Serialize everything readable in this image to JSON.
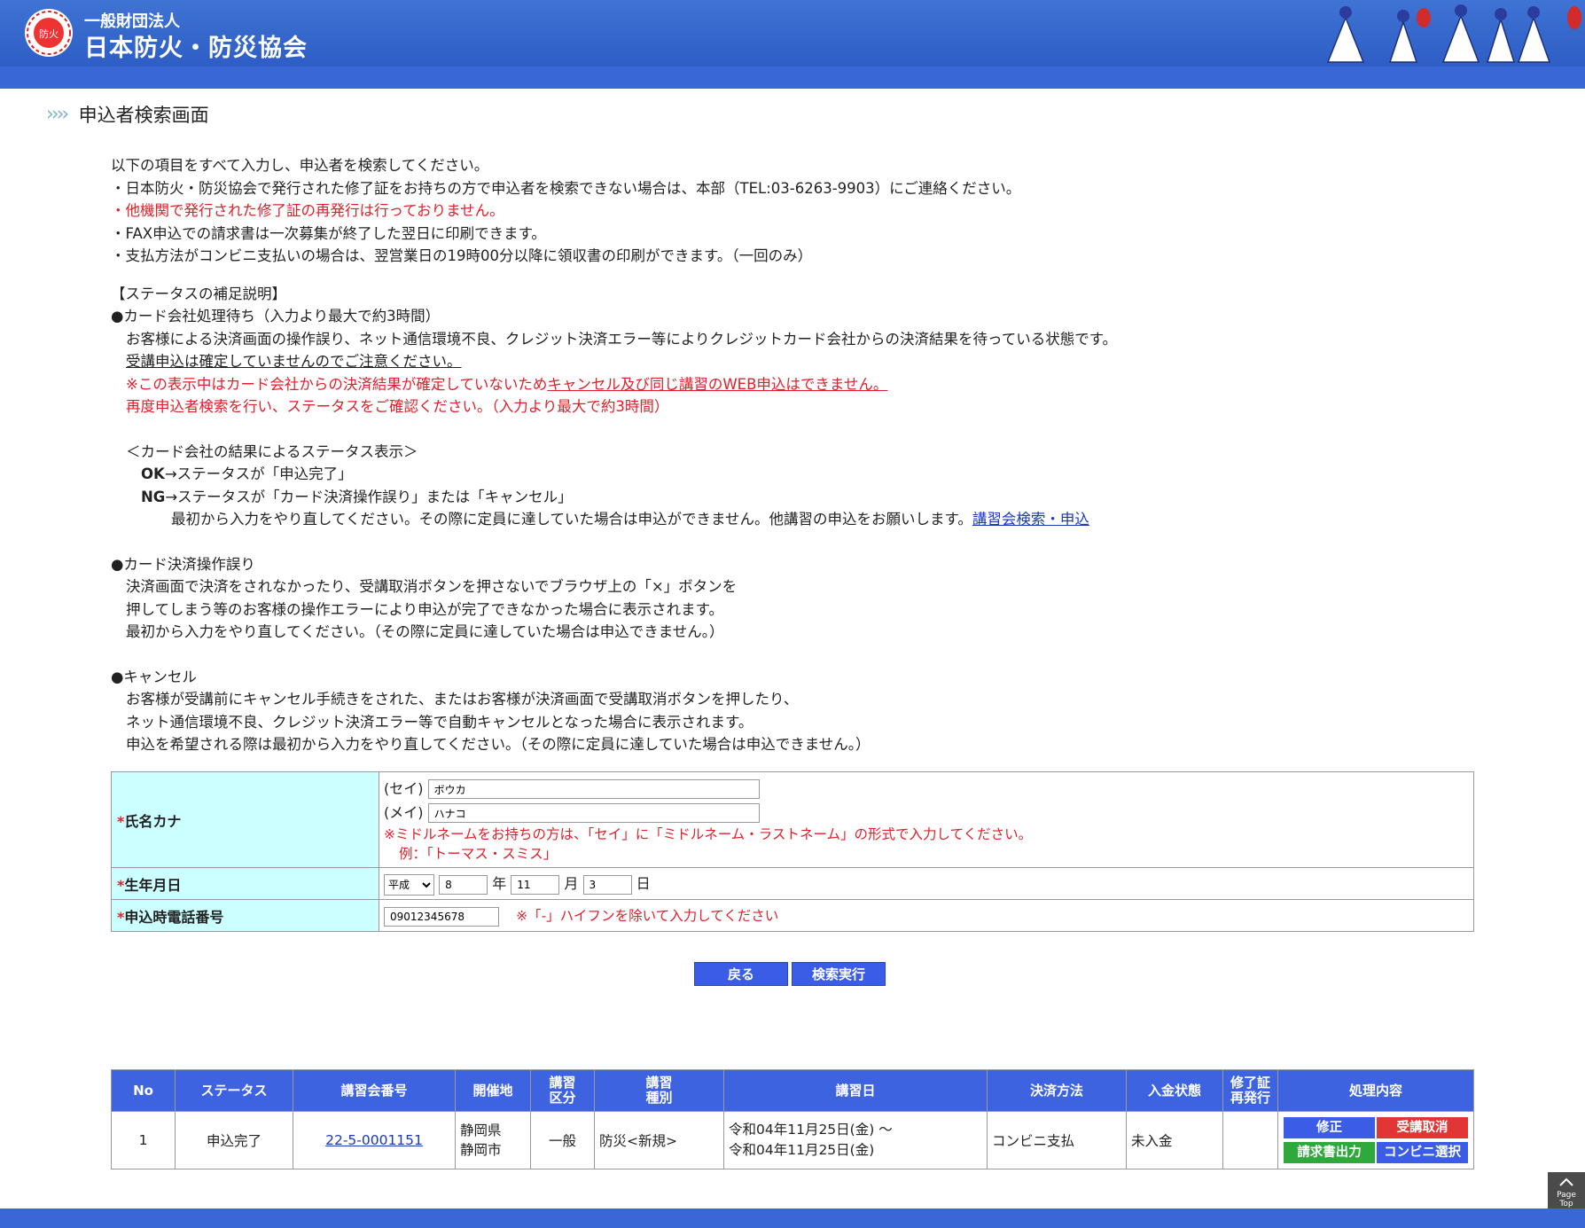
{
  "header": {
    "org_small": "一般財団法人",
    "org_name": "日本防火・防災協会",
    "logo_mark_text": "防火"
  },
  "page_title": "申込者検索画面",
  "intro": {
    "lead": "以下の項目をすべて入力し、申込者を検索してください。",
    "bullet1": "・日本防火・防災協会で発行された修了証をお持ちの方で申込者を検索できない場合は、本部（TEL:03-6263-9903）にご連絡ください。",
    "bullet2": "・他機関で発行された修了証の再発行は行っておりません。",
    "bullet3": "・FAX申込での請求書は一次募集が終了した翌日に印刷できます。",
    "bullet4": "・支払方法がコンビニ支払いの場合は、翌営業日の19時00分以降に領収書の印刷ができます。（一回のみ）"
  },
  "status_help": {
    "heading": "【ステータスの補足説明】",
    "card_wait": {
      "title": "●カード会社処理待ち（入力より最大で約3時間）",
      "line1": "お客様による決済画面の操作誤り、ネット通信環境不良、クレジット決済エラー等によりクレジットカード会社からの決済結果を待っている状態です。",
      "line2": "受講申込は確定していませんのでご注意ください。",
      "line3_a": "※この表示中はカード会社からの決済結果が確定していないため",
      "line3_b": "キャンセル及び同じ講習のWEB申込はできません。",
      "line4": "再度申込者検索を行い、ステータスをご確認ください。（入力より最大で約3時間）",
      "result_heading": "＜カード会社の結果によるステータス表示＞",
      "ok_key": "OK",
      "ok_text": "→ステータスが「申込完了」",
      "ng_key": "NG",
      "ng_text": "→ステータスが「カード決済操作誤り」または「キャンセル」",
      "ng_detail": "最初から入力をやり直してください。その際に定員に達していた場合は申込ができません。他講習の申込をお願いします。",
      "ng_link": "講習会検索・申込"
    },
    "card_error": {
      "title": "●カード決済操作誤り",
      "line1": "決済画面で決済をされなかったり、受講取消ボタンを押さないでブラウザ上の「×」ボタンを",
      "line2": "押してしまう等のお客様の操作エラーにより申込が完了できなかった場合に表示されます。",
      "line3": "最初から入力をやり直してください。（その際に定員に達していた場合は申込できません。）"
    },
    "cancel": {
      "title": "●キャンセル",
      "line1": "お客様が受講前にキャンセル手続きをされた、またはお客様が決済画面で受講取消ボタンを押したり、",
      "line2": "ネット通信環境不良、クレジット決済エラー等で自動キャンセルとなった場合に表示されます。",
      "line3": "申込を希望される際は最初から入力をやり直してください。（その際に定員に達していた場合は申込できません。）"
    }
  },
  "form": {
    "required_mark": "*",
    "name_label": "氏名カナ",
    "sei_label": "(セイ)",
    "sei_value": "ボウカ",
    "mei_label": "(メイ)",
    "mei_value": "ハナコ",
    "name_note1": "※ミドルネームをお持ちの方は、「セイ」に「ミドルネーム・ラストネーム」の形式で入力してください。",
    "name_note2": "例：「トーマス・スミス」",
    "birth_label": "生年月日",
    "era_value": "平成",
    "year_value": "8",
    "year_unit": "年",
    "month_value": "11",
    "month_unit": "月",
    "day_value": "3",
    "day_unit": "日",
    "phone_label": "申込時電話番号",
    "phone_value": "09012345678",
    "phone_note": "※「-」ハイフンを除いて入力してください"
  },
  "buttons": {
    "back": "戻る",
    "search": "検索実行"
  },
  "results": {
    "headers": {
      "no": "No",
      "status": "ステータス",
      "course_no": "講習会番号",
      "venue": "開催地",
      "kubun_1": "講習",
      "kubun_2": "区分",
      "shubetsu_1": "講習",
      "shubetsu_2": "種別",
      "date": "講習日",
      "payment": "決済方法",
      "deposit": "入金状態",
      "cert_1": "修了証",
      "cert_2": "再発行",
      "action": "処理内容"
    },
    "row": {
      "no": "1",
      "status": "申込完了",
      "course_no": "22-5-0001151",
      "venue_1": "静岡県",
      "venue_2": "静岡市",
      "kubun": "一般",
      "shubetsu": "防災<新規>",
      "date_1": "令和04年11月25日(金) ～",
      "date_2": "令和04年11月25日(金)",
      "payment": "コンビニ支払",
      "deposit": "未入金",
      "cert": "",
      "act_edit": "修正",
      "act_cancel": "受講取消",
      "act_invoice": "請求書出力",
      "act_konbini": "コンビニ選択"
    }
  },
  "pagetop": {
    "line1": "Page",
    "line2": "Top"
  },
  "colors": {
    "header_blue": "#2f5fc6",
    "label_bg": "#ccffff",
    "required_red": "#e0202a",
    "button_blue": "#3a5ce6"
  }
}
